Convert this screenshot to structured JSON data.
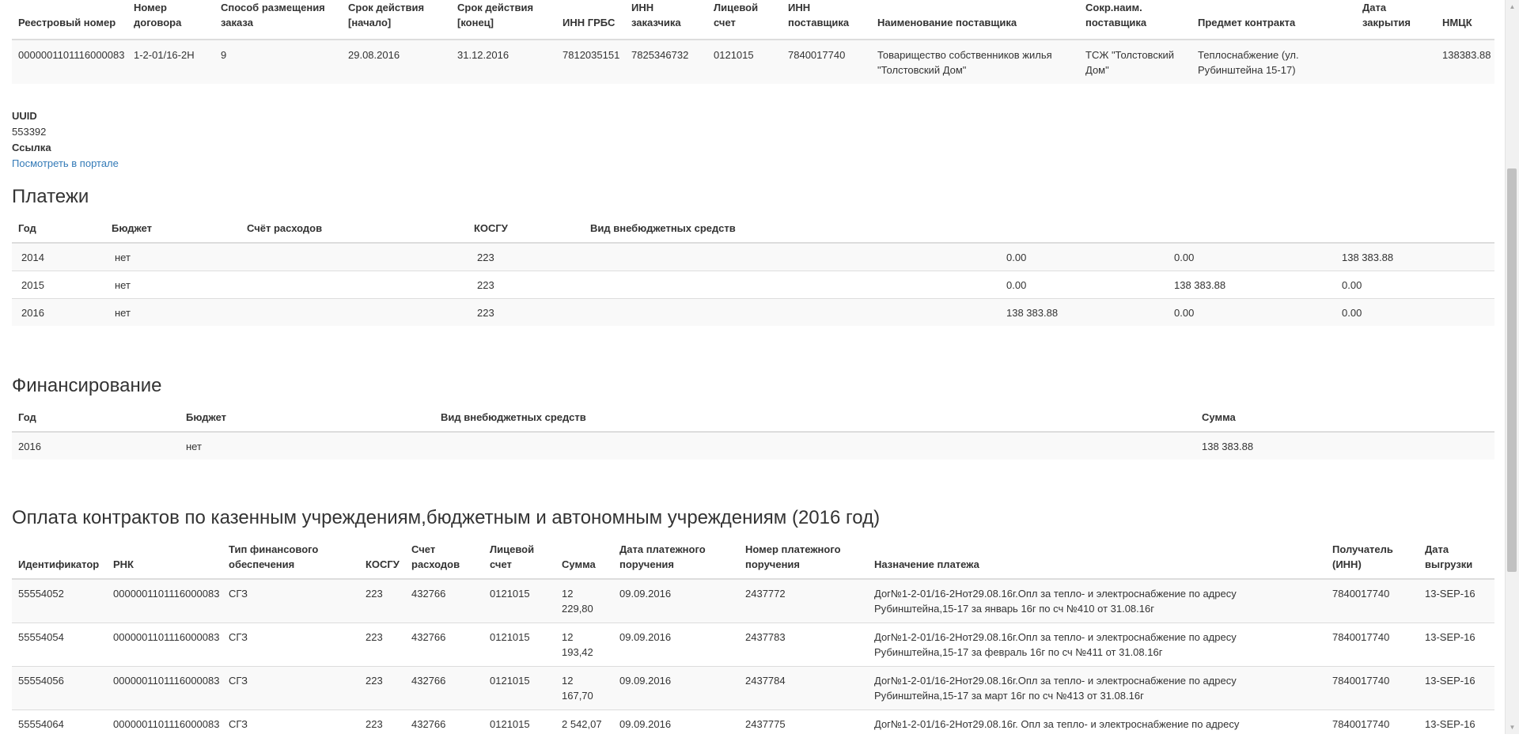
{
  "contract": {
    "headers": [
      "Реестровый номер",
      "Номер договора",
      "Способ размещения заказа",
      "Срок действия [начало]",
      "Срок действия [конец]",
      "ИНН ГРБС",
      "ИНН заказчика",
      "Лицевой счет",
      "ИНН поставщика",
      "Наименование поставщика",
      "Сокр.наим. поставщика",
      "Предмет контракта",
      "Дата закрытия",
      "НМЦК"
    ],
    "row": [
      "0000001101116000083",
      "1-2-01/16-2Н",
      "9",
      "29.08.2016",
      "31.12.2016",
      "7812035151",
      "7825346732",
      "0121015",
      "7840017740",
      "Товарищество собственников жилья \"Толстовский Дом\"",
      "ТСЖ \"Толстовский Дом\"",
      "Теплоснабжение (ул. Рубинштейна 15-17)",
      "",
      "138383.88"
    ]
  },
  "info": {
    "uuid_label": "UUID",
    "uuid_value": "553392",
    "link_label": "Ссылка",
    "link_text": "Посмотреть в портале"
  },
  "payments": {
    "title": "Платежи",
    "headers": [
      "Год",
      "Бюджет",
      "Счёт расходов",
      "КОСГУ",
      "Вид внебюджетных средств",
      "",
      "",
      ""
    ],
    "rows": [
      [
        "2014",
        "нет",
        "",
        "223",
        "",
        "0.00",
        "0.00",
        "138 383.88"
      ],
      [
        "2015",
        "нет",
        "",
        "223",
        "",
        "0.00",
        "138 383.88",
        "0.00"
      ],
      [
        "2016",
        "нет",
        "",
        "223",
        "",
        "138 383.88",
        "0.00",
        "0.00"
      ]
    ]
  },
  "financing": {
    "title": "Финансирование",
    "headers": [
      "Год",
      "Бюджет",
      "Вид внебюджетных средств",
      "Сумма"
    ],
    "rows": [
      [
        "2016",
        "нет",
        "",
        "138 383.88"
      ]
    ]
  },
  "payorders": {
    "title": "Оплата контрактов по казенным учреждениям,бюджетным и автономным учреждениям (2016 год)",
    "headers": [
      "Идентификатор",
      "РНК",
      "Тип финансового обеспечения",
      "КОСГУ",
      "Счет расходов",
      "Лицевой счет",
      "Сумма",
      "Дата платежного поручения",
      "Номер платежного поручения",
      "Назначение платежа",
      "Получатель (ИНН)",
      "Дата выгрузки"
    ],
    "rows": [
      [
        "55554052",
        "0000001101116000083",
        "СГЗ",
        "223",
        "432766",
        "0121015",
        "12 229,80",
        "09.09.2016",
        "2437772",
        "Дог№1-2-01/16-2Нот29.08.16г.Опл за тепло- и электроснабжение по адресу Рубинштейна,15-17 за январь 16г по сч №410 от 31.08.16г",
        "7840017740",
        "13-SEP-16"
      ],
      [
        "55554054",
        "0000001101116000083",
        "СГЗ",
        "223",
        "432766",
        "0121015",
        "12 193,42",
        "09.09.2016",
        "2437783",
        "Дог№1-2-01/16-2Нот29.08.16г.Опл за тепло- и электроснабжение по адресу Рубинштейна,15-17 за февраль 16г по сч №411 от 31.08.16г",
        "7840017740",
        "13-SEP-16"
      ],
      [
        "55554056",
        "0000001101116000083",
        "СГЗ",
        "223",
        "432766",
        "0121015",
        "12 167,70",
        "09.09.2016",
        "2437784",
        "Дог№1-2-01/16-2Нот29.08.16г.Опл за тепло- и электроснабжение по адресу Рубинштейна,15-17 за март 16г по сч №413 от 31.08.16г",
        "7840017740",
        "13-SEP-16"
      ],
      [
        "55554064",
        "0000001101116000083",
        "СГЗ",
        "223",
        "432766",
        "0121015",
        "2 542,07",
        "09.09.2016",
        "2437775",
        "Дог№1-2-01/16-2Нот29.08.16г. Опл за тепло- и электроснабжение по адресу",
        "7840017740",
        "13-SEP-16"
      ]
    ]
  }
}
